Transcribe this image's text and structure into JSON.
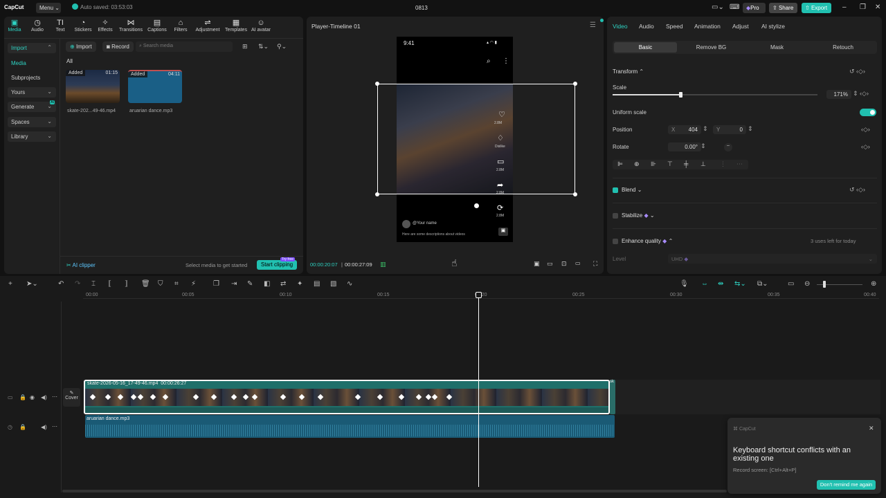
{
  "topbar": {
    "logo": "CapCut",
    "menu": "Menu",
    "autosave": "Auto saved: 03:53:03",
    "project_title": "0813",
    "pro": "Pro",
    "share": "Share",
    "export": "Export"
  },
  "media_tools": [
    {
      "label": "Media",
      "icon": "media-icon"
    },
    {
      "label": "Audio",
      "icon": "audio-icon"
    },
    {
      "label": "Text",
      "icon": "text-icon"
    },
    {
      "label": "Stickers",
      "icon": "stickers-icon"
    },
    {
      "label": "Effects",
      "icon": "effects-icon"
    },
    {
      "label": "Transitions",
      "icon": "transitions-icon"
    },
    {
      "label": "Captions",
      "icon": "captions-icon"
    },
    {
      "label": "Filters",
      "icon": "filters-icon"
    },
    {
      "label": "Adjustment",
      "icon": "adjustment-icon"
    },
    {
      "label": "Templates",
      "icon": "templates-icon"
    },
    {
      "label": "AI avatar",
      "icon": "ai-avatar-icon"
    }
  ],
  "sidebar": {
    "import": "Import",
    "media": "Media",
    "subprojects": "Subprojects",
    "yours": "Yours",
    "generate": "Generate",
    "generate_badge": "AI",
    "spaces": "Spaces",
    "library": "Library"
  },
  "media_panel": {
    "import_btn": "Import",
    "record_btn": "Record",
    "search_placeholder": "Search media",
    "filter_all": "All",
    "items": [
      {
        "name": "skate-202...49-46.mp4",
        "badge": "Added",
        "duration": "01:15"
      },
      {
        "name": "aruarian dance.mp3",
        "badge": "Added",
        "duration": "04:11"
      }
    ],
    "ai_clipper": "AI clipper",
    "hint": "Select media to get started",
    "start_clipping": "Start clipping",
    "try_free": "Try free"
  },
  "player": {
    "title": "Player-Timeline 01",
    "phone_time": "9:41",
    "counts": [
      "2.8M",
      "Dislike",
      "2.8M",
      "2.8M",
      "2.8M"
    ],
    "username": "@Your name",
    "description": "Here are some descriptions about videos",
    "current_time": "00:00:20:07",
    "total_time": "00:00:27:09"
  },
  "inspector": {
    "tabs": [
      "Video",
      "Audio",
      "Speed",
      "Animation",
      "Adjust",
      "AI stylize"
    ],
    "subtabs": [
      "Basic",
      "Remove BG",
      "Mask",
      "Retouch"
    ],
    "transform": "Transform",
    "scale_label": "Scale",
    "scale_value": "171%",
    "scale_fraction": 0.33,
    "uniform_scale": "Uniform scale",
    "position": "Position",
    "pos_x_label": "X",
    "pos_x": "404",
    "pos_y_label": "Y",
    "pos_y": "0",
    "rotate": "Rotate",
    "rotate_value": "0.00°",
    "blend": "Blend",
    "stabilize": "Stabilize",
    "enhance_quality": "Enhance quality",
    "uses_left": "3 uses left for today",
    "level_label": "Level",
    "level_value": "UHD"
  },
  "timeline": {
    "ruler": [
      "00:00",
      "00:05",
      "00:10",
      "00:15",
      "00:20",
      "00:25",
      "00:30",
      "00:35",
      "00:40"
    ],
    "video_clip_name": "skate-2026-05-16_17-49-46.mp4",
    "video_clip_dur": "00:00:26:27",
    "audio_clip_name": "aruarian dance.mp3",
    "cover": "Cover"
  },
  "toast": {
    "app": "CapCut",
    "title": "Keyboard shortcut conflicts with an existing one",
    "detail": "Record screen: [Ctrl+Alt+P]",
    "button": "Don't remind me again"
  },
  "colors": {
    "accent": "#2ed3c3",
    "clip_border": "#2a8f86",
    "audio": "#1a5a75"
  }
}
